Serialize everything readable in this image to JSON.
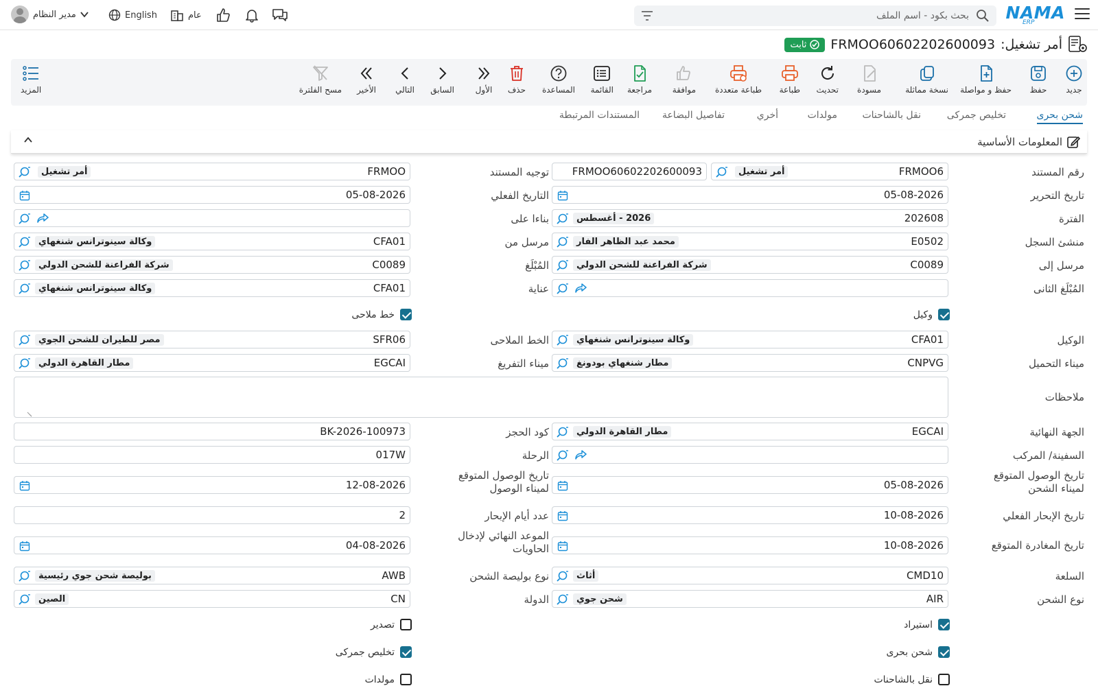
{
  "topbar": {
    "logo_main": "NAMA",
    "logo_sub": "ERP",
    "search_placeholder": "بحث بكود - اسم الملف",
    "user_name": "مدير النظام",
    "language": "English",
    "branch": "عام"
  },
  "title": {
    "prefix": "أمر تشغيل:",
    "doc_code": "FRMOO60602202600093",
    "status": "ثابت"
  },
  "toolbar": [
    {
      "key": "new",
      "label": "جديد",
      "icon": "plus-circle-icon",
      "color": "#1a6fa8"
    },
    {
      "key": "save",
      "label": "حفظ",
      "icon": "save-icon",
      "color": "#1a6fa8"
    },
    {
      "key": "save-continue",
      "label": "حفظ و مواصلة",
      "icon": "file-plus-icon",
      "color": "#1a6fa8"
    },
    {
      "key": "copy",
      "label": "نسخة مماثلة",
      "icon": "copy-icon",
      "color": "#1a6fa8"
    },
    {
      "key": "draft",
      "label": "مسودة",
      "icon": "draft-icon",
      "color": "#bbbbbb"
    },
    {
      "key": "refresh",
      "label": "تحديث",
      "icon": "refresh-icon",
      "color": "#222222"
    },
    {
      "key": "print",
      "label": "طباعة",
      "icon": "printer-icon",
      "color": "#e8612c"
    },
    {
      "key": "multi-print",
      "label": "طباعة متعددة",
      "icon": "multi-printer-icon",
      "color": "#e8612c"
    },
    {
      "key": "approve",
      "label": "موافقة",
      "icon": "thumbs-up-icon",
      "color": "#bbbbbb"
    },
    {
      "key": "review",
      "label": "مراجعة",
      "icon": "file-check-icon",
      "color": "#1f9d55"
    },
    {
      "key": "list",
      "label": "القائمة",
      "icon": "list-icon",
      "color": "#222222"
    },
    {
      "key": "help",
      "label": "المساعدة",
      "icon": "help-icon",
      "color": "#333333"
    },
    {
      "key": "delete",
      "label": "حذف",
      "icon": "trash-icon",
      "color": "#d93025"
    },
    {
      "key": "first",
      "label": "الأول",
      "icon": "double-chevron-right-icon",
      "color": "#222222"
    },
    {
      "key": "prev",
      "label": "السابق",
      "icon": "chevron-right-icon",
      "color": "#222222"
    },
    {
      "key": "next",
      "label": "التالي",
      "icon": "chevron-left-icon",
      "color": "#222222"
    },
    {
      "key": "last",
      "label": "الأخير",
      "icon": "double-chevron-left-icon",
      "color": "#222222"
    },
    {
      "key": "clear-filter",
      "label": "مسح الفلترة",
      "icon": "filter-off-icon",
      "color": "#bbbbbb"
    }
  ],
  "more_label": "المزيد",
  "tabs": [
    {
      "label": "شحن بحرى",
      "active": true
    },
    {
      "label": "تخليص جمركى"
    },
    {
      "label": "نقل بالشاحنات"
    },
    {
      "label": "مولدات"
    },
    {
      "label": "أخري"
    },
    {
      "label": "تفاصيل البضاعة"
    },
    {
      "label": "المستندات المرتبطة"
    }
  ],
  "section_title": "المعلومات الأساسية",
  "form": {
    "doc_number": {
      "label": "رقم المستند",
      "code": "FRMOO6",
      "name": "أمر تشغيل",
      "full": "FRMOO60602202600093"
    },
    "doc_direction": {
      "label": "توجيه المستند",
      "code": "FRMOO",
      "name": "أمر تشغيل"
    },
    "edit_date": {
      "label": "تاريخ التحرير",
      "value": "05-08-2026"
    },
    "actual_date": {
      "label": "التاريخ الفعلي",
      "value": "05-08-2026"
    },
    "period": {
      "label": "الفترة",
      "code": "202608",
      "name": "2026 - أغسطس"
    },
    "based_on": {
      "label": "بناءا على"
    },
    "creator": {
      "label": "منشئ السجل",
      "code": "E0502",
      "name": "محمد عبد الظاهر الفار"
    },
    "sent_from": {
      "label": "مرسل من",
      "code": "CFA01",
      "name": "وكالة سينوترانس شنغهاي"
    },
    "sent_to": {
      "label": "مرسل إلى",
      "code": "C0089",
      "name": "شركة الفراعنة للشحن الدولي"
    },
    "notified": {
      "label": "المُبْلَغ",
      "code": "C0089",
      "name": "شركة الفراعنة للشحن الدولي"
    },
    "second_notified": {
      "label": "المُبْلَغ الثانى"
    },
    "care_of": {
      "label": "عناية",
      "code": "CFA01",
      "name": "وكالة سينوترانس شنغهاي"
    },
    "agent_check": {
      "label": "وكيل",
      "checked": true
    },
    "shipping_line_check": {
      "label": "خط ملاحى",
      "checked": true
    },
    "agent": {
      "label": "الوكيل",
      "code": "CFA01",
      "name": "وكالة سينوترانس شنغهاي"
    },
    "shipping_line": {
      "label": "الخط الملاحى",
      "code": "SFR06",
      "name": "مصر للطيران للشحن الجوي"
    },
    "loading_port": {
      "label": "ميناء التحميل",
      "code": "CNPVG",
      "name": "مطار شنغهاي بودونغ"
    },
    "discharge_port": {
      "label": "ميناء التفريغ",
      "code": "EGCAI",
      "name": "مطار القاهرة الدولي"
    },
    "notes": {
      "label": "ملاحظات"
    },
    "final_destination": {
      "label": "الجهة النهائية",
      "code": "EGCAI",
      "name": "مطار القاهرة الدولي"
    },
    "booking_code": {
      "label": "كود الحجز",
      "value": "BK-2026-100973"
    },
    "vessel": {
      "label": "السفينة/ المركب"
    },
    "voyage": {
      "label": "الرحلة",
      "value": "017W"
    },
    "eta_loading": {
      "label_1": "تاريخ الوصول المتوقع",
      "label_2": "لميناء الشحن",
      "value": "05-08-2026"
    },
    "eta_arrival": {
      "label_1": "تاريخ الوصول المتوقع",
      "label_2": "لميناء الوصول",
      "value": "12-08-2026"
    },
    "actual_sailing": {
      "label": "تاريخ الإبحار الفعلي",
      "value": "10-08-2026"
    },
    "sailing_days": {
      "label": "عدد أيام الإبحار",
      "value": "2"
    },
    "expected_departure": {
      "label": "تاريخ المغادرة المتوقع",
      "value": "10-08-2026"
    },
    "container_deadline": {
      "label_1": "الموعد النهائي لإدخال",
      "label_2": "الحاويات",
      "value": "04-08-2026"
    },
    "commodity": {
      "label": "السلعة",
      "code": "CMD10",
      "name": "أثاث"
    },
    "bl_type": {
      "label": "نوع بوليصة الشحن",
      "code": "AWB",
      "name": "بوليصة شحن جوي رئيسية"
    },
    "shipment_type": {
      "label": "نوع الشحن",
      "code": "AIR",
      "name": "شحن جوي"
    },
    "country": {
      "label": "الدولة",
      "code": "CN",
      "name": "الصين"
    },
    "import_check": {
      "label": "استيراد",
      "checked": true
    },
    "export_check": {
      "label": "تصدير",
      "checked": false
    },
    "sea_check": {
      "label": "شحن بحرى",
      "checked": true
    },
    "customs_check": {
      "label": "تخليص جمركى",
      "checked": true
    },
    "trucking_check": {
      "label": "نقل بالشاحنات",
      "checked": false
    },
    "generators_check": {
      "label": "مولدات",
      "checked": false
    }
  }
}
